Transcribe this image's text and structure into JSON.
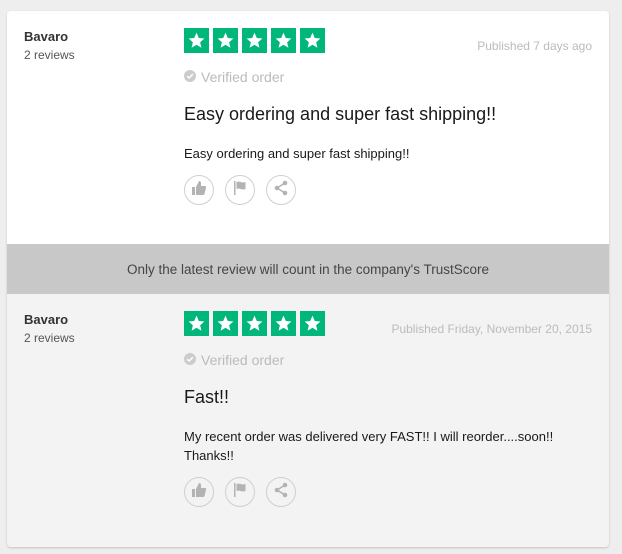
{
  "reviews": [
    {
      "reviewer_name": "Bavaro",
      "review_count": "2 reviews",
      "rating": 5,
      "published": "Published 7 days ago",
      "verified": "Verified order",
      "title": "Easy ordering and super fast shipping!!",
      "body": "Easy ordering and super fast shipping!!",
      "actions": [
        "thumbs-up-icon",
        "flag-icon",
        "share-icon"
      ]
    },
    {
      "reviewer_name": "Bavaro",
      "review_count": "2 reviews",
      "rating": 5,
      "published": "Published Friday, November 20, 2015",
      "verified": "Verified order",
      "title": "Fast!!",
      "body": "My recent order was delivered very FAST!! I will reorder....soon!! Thanks!!",
      "actions": [
        "thumbs-up-icon",
        "flag-icon",
        "share-icon"
      ]
    }
  ],
  "notice": "Only the latest review will count in the company's TrustScore",
  "colors": {
    "star_green": "#00b67a",
    "divider_bg": "#c8c8c8",
    "muted_text": "#bbbbbb"
  }
}
